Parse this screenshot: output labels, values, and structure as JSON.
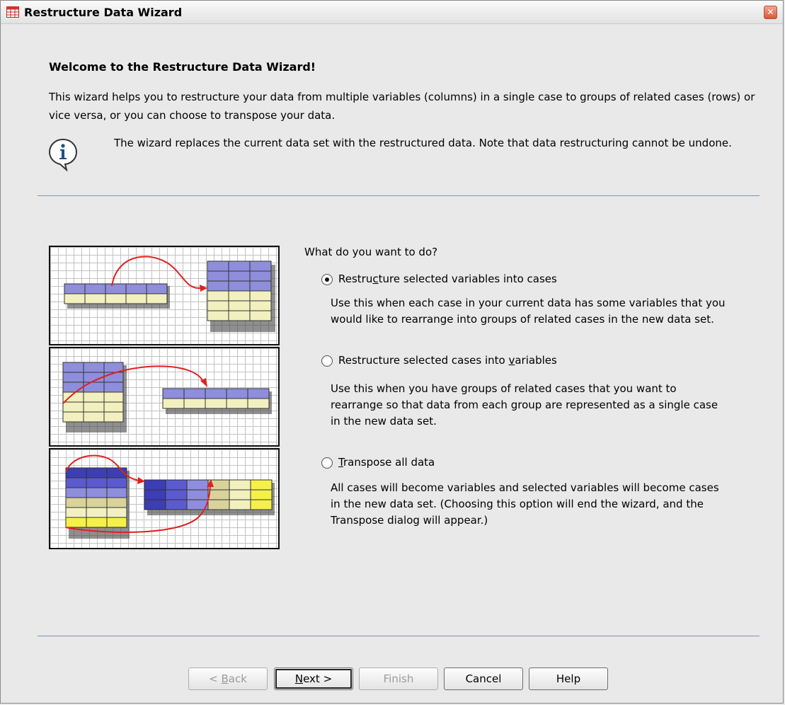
{
  "window": {
    "title": "Restructure Data Wizard"
  },
  "heading": "Welcome to the Restructure Data Wizard!",
  "intro": "This wizard helps you to restructure your data from multiple variables (columns) in a single case to groups of related cases (rows) or vice versa, or you can choose to transpose your data.",
  "note": "The wizard replaces the current data set with the restructured data. Note that data restructuring cannot be undone.",
  "question": "What do you want to do?",
  "options": [
    {
      "label_pre": "Restru",
      "label_key": "c",
      "label_post": "ture selected variables into cases",
      "selected": true,
      "desc": "Use this when each case in your current data has some variables that you would like to rearrange into groups of related cases in the new data set."
    },
    {
      "label_pre": "Restructure selected cases into ",
      "label_key": "v",
      "label_post": "ariables",
      "selected": false,
      "desc": "Use this when you have groups of related cases that you want to rearrange so that data from each group are represented as a single case in the new data set."
    },
    {
      "label_pre": "",
      "label_key": "T",
      "label_post": "ranspose all data",
      "selected": false,
      "desc": "All cases will become variables and selected variables will become cases in the new data set. (Choosing this option will end the wizard, and the Transpose dialog will appear.)"
    }
  ],
  "buttons": {
    "back": {
      "pre": "< ",
      "key": "B",
      "post": "ack",
      "enabled": false
    },
    "next": {
      "pre": "",
      "key": "N",
      "post": "ext >",
      "enabled": true
    },
    "finish": {
      "label": "Finish",
      "enabled": false
    },
    "cancel": {
      "label": "Cancel",
      "enabled": true
    },
    "help": {
      "label": "Help",
      "enabled": true
    }
  },
  "icons": {
    "app": "spreadsheet-icon",
    "close": "close-icon",
    "info": "info-icon"
  },
  "colors": {
    "purple_header": "#8e8edc",
    "cream_cell": "#f3f0bf",
    "navy": "#2a2a8c",
    "yellow": "#f6f04b",
    "arrow": "#e02020",
    "separator": "#7b96ad"
  }
}
